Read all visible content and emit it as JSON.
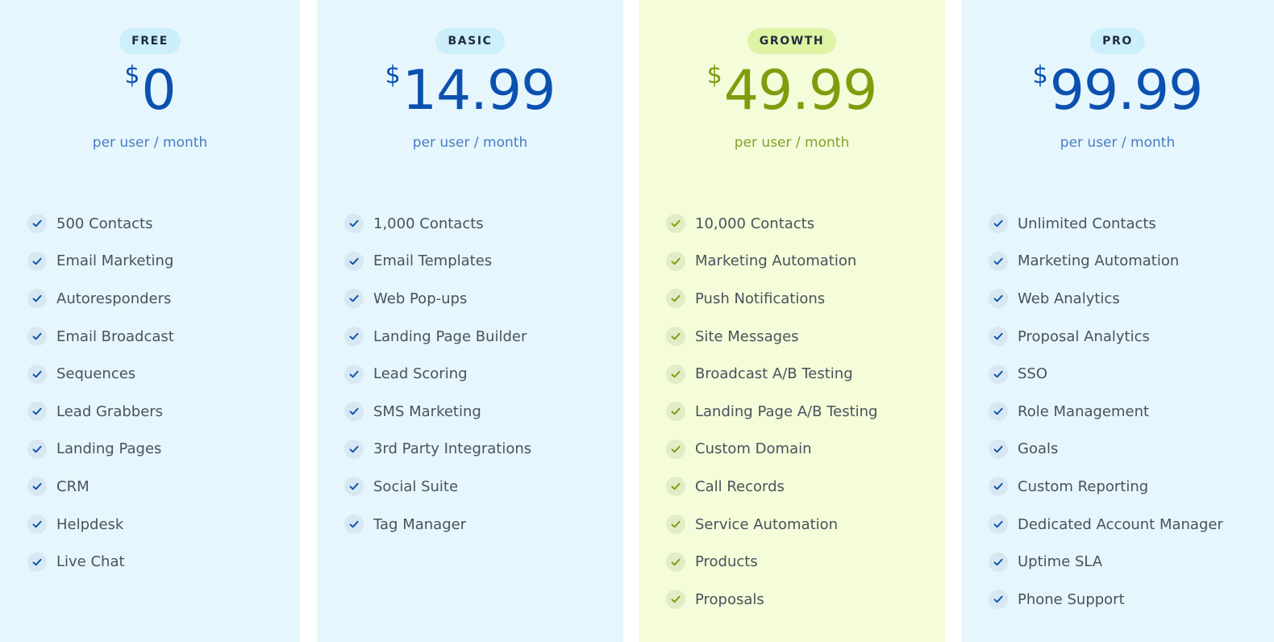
{
  "plans": [
    {
      "key": "free",
      "badge": "FREE",
      "currency": "$",
      "price": "0",
      "period": "per user / month",
      "features": [
        "500 Contacts",
        "Email Marketing",
        "Autoresponders",
        "Email Broadcast",
        "Sequences",
        "Lead Grabbers",
        "Landing Pages",
        "CRM",
        "Helpdesk",
        "Live Chat"
      ]
    },
    {
      "key": "basic",
      "badge": "BASIC",
      "currency": "$",
      "price": "14.99",
      "period": "per user / month",
      "features": [
        "1,000 Contacts",
        "Email Templates",
        "Web Pop-ups",
        "Landing Page Builder",
        "Lead Scoring",
        "SMS Marketing",
        "3rd Party Integrations",
        "Social Suite",
        "Tag Manager"
      ]
    },
    {
      "key": "growth",
      "badge": "GROWTH",
      "currency": "$",
      "price": "49.99",
      "period": "per user / month",
      "features": [
        "10,000 Contacts",
        "Marketing Automation",
        "Push Notifications",
        "Site Messages",
        "Broadcast A/B Testing",
        "Landing Page A/B Testing",
        "Custom Domain",
        "Call Records",
        "Service Automation",
        "Products",
        "Proposals"
      ]
    },
    {
      "key": "pro",
      "badge": "PRO",
      "currency": "$",
      "price": "99.99",
      "period": "per user / month",
      "features": [
        "Unlimited Contacts",
        "Marketing Automation",
        "Web Analytics",
        "Proposal Analytics",
        "SSO",
        "Role Management",
        "Goals",
        "Custom Reporting",
        "Dedicated Account Manager",
        "Uptime SLA",
        "Phone Support"
      ]
    }
  ],
  "colors": {
    "card_bg": "#e6f6fd",
    "card_bg_highlight": "#f4fcd9",
    "price_blue": "#0a51b0",
    "price_green": "#7e9d0d",
    "badge_blue": "#cdeefb",
    "badge_green": "#def3a3",
    "feature_text": "#4a525c"
  },
  "icons": {
    "feature_check": "check-icon"
  }
}
